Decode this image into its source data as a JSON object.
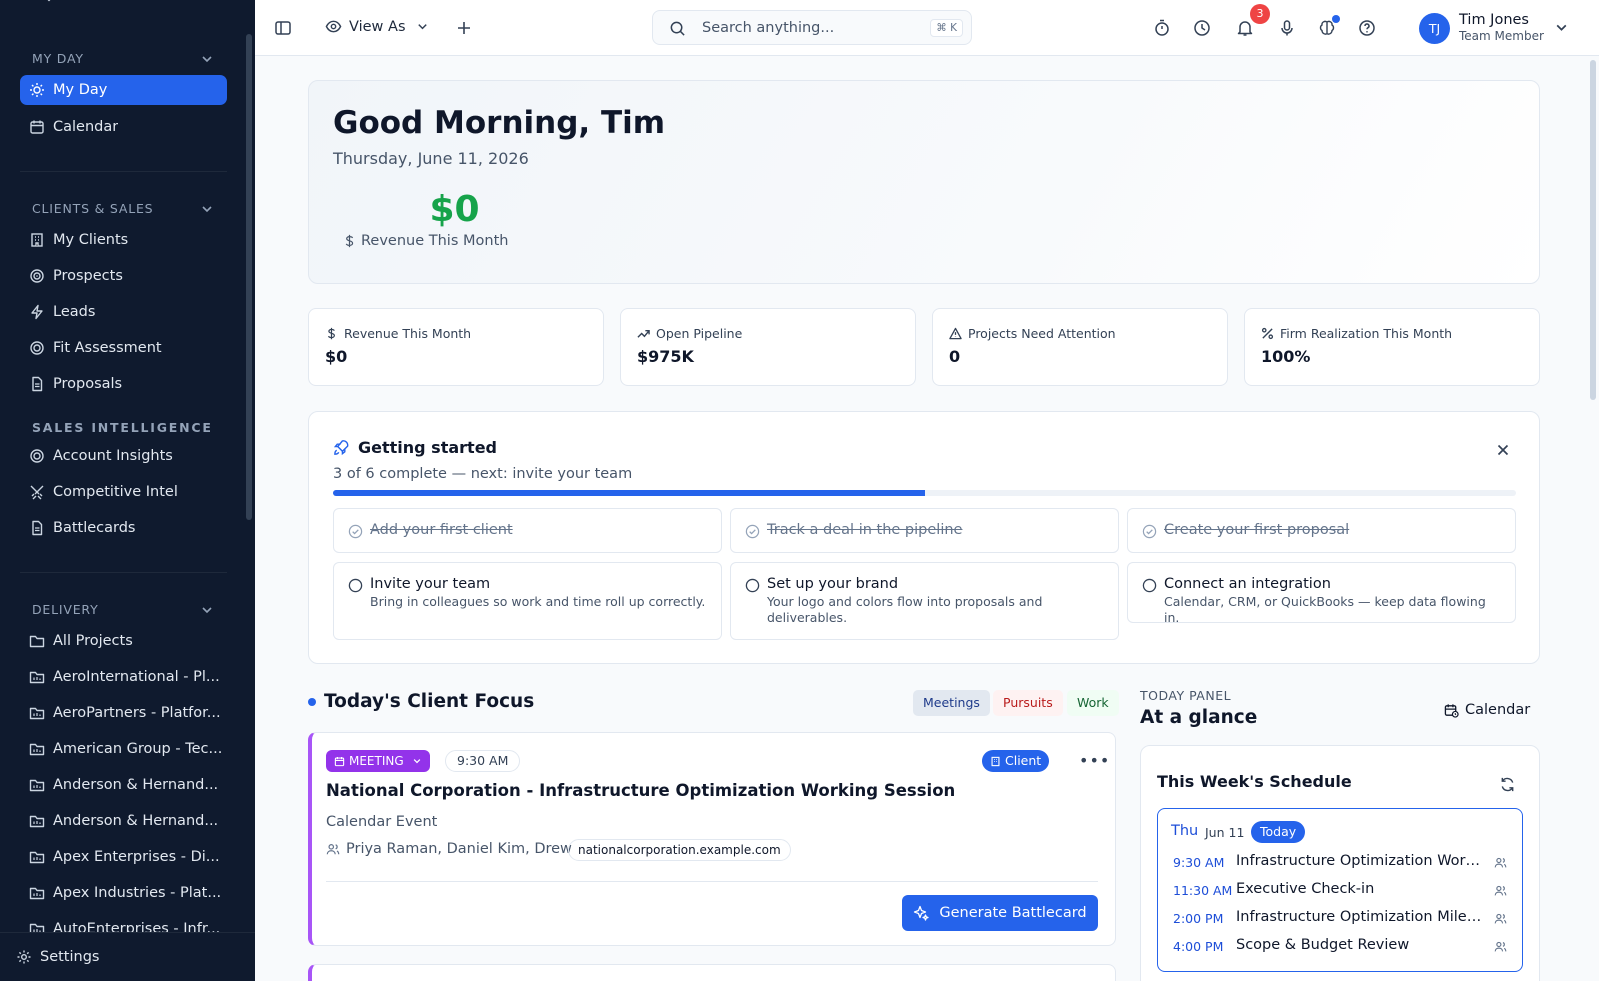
{
  "sidebar": {
    "sections": {
      "my_day": "MY DAY",
      "clients_sales": "CLIENTS & SALES",
      "sales_intel": "SALES INTELLIGENCE",
      "delivery": "DELIVERY"
    },
    "items": {
      "my_day": "My Day",
      "calendar": "Calendar",
      "my_clients": "My Clients",
      "prospects": "Prospects",
      "leads": "Leads",
      "fit_assessment": "Fit Assessment",
      "proposals": "Proposals",
      "account_insights": "Account Insights",
      "competitive_intel": "Competitive Intel",
      "battlecards": "Battlecards",
      "all_projects": "All Projects"
    },
    "projects": [
      "AeroInternational - Pl...",
      "AeroPartners - Platfor...",
      "American Group - Tec...",
      "Anderson & Hernand...",
      "Anderson & Hernand...",
      "Apex Enterprises - Di...",
      "Apex Industries - Plat...",
      "AutoEnterprises - Infr..."
    ],
    "settings": "Settings"
  },
  "topbar": {
    "view_as": "View As",
    "search_placeholder": "Search anything...",
    "search_shortcut": "⌘ K",
    "notification_count": "3",
    "user": {
      "initials": "TJ",
      "name": "Tim Jones",
      "role": "Team Member"
    }
  },
  "hero": {
    "greeting": "Good Morning, Tim",
    "date": "Thursday, June 11, 2026",
    "revenue_value": "$0",
    "revenue_label": "Revenue This Month"
  },
  "stats": [
    {
      "label": "Revenue This Month",
      "value": "$0",
      "icon": "dollar-icon"
    },
    {
      "label": "Open Pipeline",
      "value": "$975K",
      "icon": "trending-up-icon"
    },
    {
      "label": "Projects Need Attention",
      "value": "0",
      "icon": "alert-triangle-icon"
    },
    {
      "label": "Firm Realization This Month",
      "value": "100%",
      "icon": "percent-icon"
    }
  ],
  "getting_started": {
    "title": "Getting started",
    "subtitle": "3 of 6 complete — next: invite your team",
    "progress_fraction": 0.5,
    "tasks": [
      {
        "title": "Add your first client",
        "desc": "",
        "done": true
      },
      {
        "title": "Track a deal in the pipeline",
        "desc": "",
        "done": true
      },
      {
        "title": "Create your first proposal",
        "desc": "",
        "done": true
      },
      {
        "title": "Invite your team",
        "desc": "Bring in colleagues so work and time roll up correctly.",
        "done": false
      },
      {
        "title": "Set up your brand",
        "desc": "Your logo and colors flow into proposals and deliverables.",
        "done": false
      },
      {
        "title": "Connect an integration",
        "desc": "Calendar, CRM, or QuickBooks — keep data flowing in.",
        "done": false
      }
    ]
  },
  "client_focus": {
    "title": "Today's Client Focus",
    "filters": {
      "meetings": "Meetings",
      "pursuits": "Pursuits",
      "work": "Work"
    },
    "card": {
      "tag": "MEETING",
      "time": "9:30 AM",
      "client_badge": "Client",
      "title": "National Corporation - Infrastructure Optimization Working Session",
      "type": "Calendar Event",
      "attendees": "Priya Raman, Daniel Kim, Drew",
      "domain": "nationalcorporation.example.com",
      "action": "Generate Battlecard"
    }
  },
  "today_panel": {
    "kicker": "TODAY PANEL",
    "title": "At a glance",
    "calendar_link": "Calendar",
    "schedule": {
      "title": "This Week's Schedule",
      "day_name": "Thu",
      "day_date": "Jun 11",
      "today_label": "Today",
      "events": [
        {
          "time": "9:30 AM",
          "name": "Infrastructure Optimization Worki..."
        },
        {
          "time": "11:30 AM",
          "name": "Executive Check-in"
        },
        {
          "time": "2:00 PM",
          "name": "Infrastructure Optimization Miles..."
        },
        {
          "time": "4:00 PM",
          "name": "Scope & Budget Review"
        }
      ]
    }
  },
  "colors": {
    "sidebar_bg": "#0f1a2e",
    "accent": "#2563eb",
    "revenue_green": "#16a34a",
    "meeting_purple": "#9333ea",
    "badge_red": "#ef4444"
  }
}
